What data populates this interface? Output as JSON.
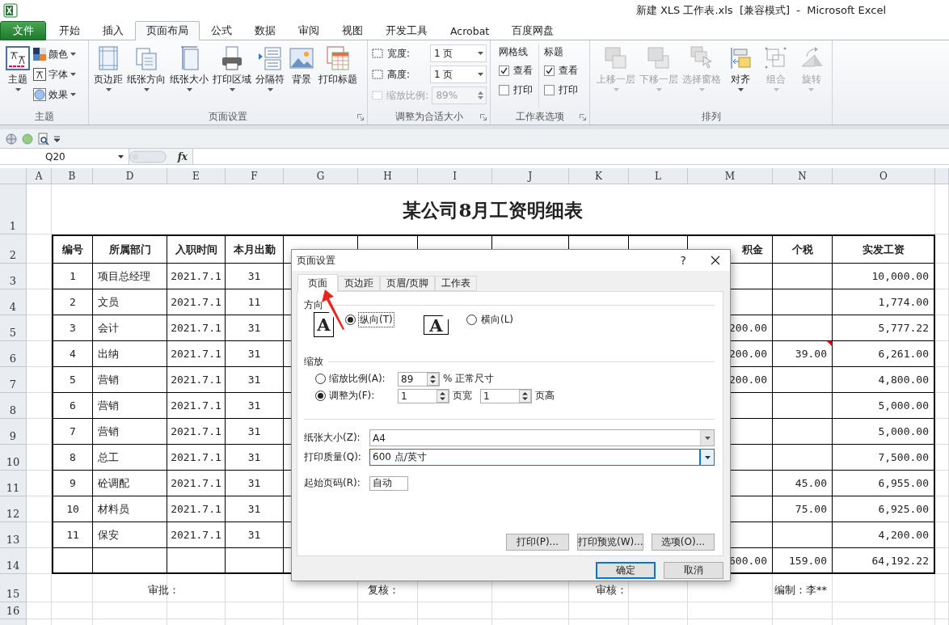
{
  "window": {
    "title": "新建 XLS 工作表.xls  [兼容模式]  -  Microsoft Excel"
  },
  "ribbon_tabs": [
    {
      "label": "文件",
      "kind": "file",
      "selected": false
    },
    {
      "label": "开始",
      "kind": "tab",
      "selected": false
    },
    {
      "label": "插入",
      "kind": "tab",
      "selected": false
    },
    {
      "label": "页面布局",
      "kind": "tab",
      "selected": true
    },
    {
      "label": "公式",
      "kind": "tab",
      "selected": false
    },
    {
      "label": "数据",
      "kind": "tab",
      "selected": false
    },
    {
      "label": "审阅",
      "kind": "tab",
      "selected": false
    },
    {
      "label": "视图",
      "kind": "tab",
      "selected": false
    },
    {
      "label": "开发工具",
      "kind": "tab",
      "selected": false
    },
    {
      "label": "Acrobat",
      "kind": "tab",
      "selected": false
    },
    {
      "label": "百度网盘",
      "kind": "tab",
      "selected": false
    }
  ],
  "ribbon": {
    "theme": {
      "title": "主题",
      "main": "主题",
      "options": [
        "颜色",
        "字体",
        "效果"
      ]
    },
    "page_setup": {
      "title": "页面设置",
      "buttons": [
        {
          "label": "页边距",
          "dropdown": true
        },
        {
          "label": "纸张方向",
          "dropdown": true
        },
        {
          "label": "纸张大小",
          "dropdown": true
        },
        {
          "label": "打印区域",
          "dropdown": true
        },
        {
          "label": "分隔符",
          "dropdown": true
        },
        {
          "label": "背景",
          "dropdown": false
        },
        {
          "label": "打印标题",
          "dropdown": false
        }
      ]
    },
    "scale": {
      "title": "调整为合适大小",
      "fields": [
        {
          "label": "宽度:",
          "value": "1 页",
          "kind": "dropdown",
          "disabled": false
        },
        {
          "label": "高度:",
          "value": "1 页",
          "kind": "dropdown",
          "disabled": false
        },
        {
          "label": "缩放比例:",
          "value": "89%",
          "kind": "spinner",
          "disabled": true
        }
      ]
    },
    "sheet_options": {
      "title": "工作表选项",
      "columns": [
        {
          "title": "网格线",
          "options": [
            {
              "label": "查看",
              "checked": true
            },
            {
              "label": "打印",
              "checked": false
            }
          ]
        },
        {
          "title": "标题",
          "options": [
            {
              "label": "查看",
              "checked": true
            },
            {
              "label": "打印",
              "checked": false
            }
          ]
        }
      ]
    },
    "arrange": {
      "title": "排列",
      "buttons": [
        {
          "label": "上移一层",
          "disabled": true
        },
        {
          "label": "下移一层",
          "disabled": true
        },
        {
          "label": "选择窗格",
          "disabled": true
        },
        {
          "label": "对齐",
          "disabled": false
        },
        {
          "label": "组合",
          "disabled": true
        },
        {
          "label": "旋转",
          "disabled": true
        }
      ]
    }
  },
  "formula_bar": {
    "name_box": "Q20",
    "fx": "fx"
  },
  "sheet": {
    "columns": [
      "A",
      "B",
      "D",
      "E",
      "F",
      "G",
      "H",
      "I",
      "J",
      "K",
      "L",
      "M",
      "N",
      "O"
    ],
    "row_numbers": [
      "1",
      "2",
      "3",
      "4",
      "5",
      "6",
      "7",
      "8",
      "9",
      "10",
      "11",
      "12",
      "13",
      "14",
      "15",
      "16"
    ],
    "title": "某公司8月工资明细表",
    "header": {
      "B": "编号",
      "D": "所属部门",
      "E": "入职时间",
      "F": "本月出勤",
      "M": "积金",
      "N": "个税",
      "O": "实发工资"
    },
    "rows": [
      {
        "B": "1",
        "D": "项目总经理",
        "E": "2021.7.1",
        "F": "31",
        "O": "10,000.00"
      },
      {
        "B": "2",
        "D": "文员",
        "E": "2021.7.1",
        "F": "11",
        "O": "1,774.00"
      },
      {
        "B": "3",
        "D": "会计",
        "E": "2021.7.1",
        "F": "31",
        "M": "200.00",
        "O": "5,777.22"
      },
      {
        "B": "4",
        "D": "出纳",
        "E": "2021.7.1",
        "F": "31",
        "M": "200.00",
        "N": "39.00",
        "O": "6,261.00",
        "comment": true
      },
      {
        "B": "5",
        "D": "营销",
        "E": "2021.7.1",
        "F": "31",
        "M": "200.00",
        "O": "4,800.00"
      },
      {
        "B": "6",
        "D": "营销",
        "E": "2021.7.1",
        "F": "31",
        "O": "5,000.00"
      },
      {
        "B": "7",
        "D": "营销",
        "E": "2021.7.1",
        "F": "31",
        "O": "5,000.00"
      },
      {
        "B": "8",
        "D": "总工",
        "E": "2021.7.1",
        "F": "31",
        "O": "7,500.00"
      },
      {
        "B": "9",
        "D": "砼调配",
        "E": "2021.7.1",
        "F": "31",
        "N": "45.00",
        "O": "6,955.00"
      },
      {
        "B": "10",
        "D": "材料员",
        "E": "2021.7.1",
        "F": "31",
        "N": "75.00",
        "O": "6,925.00"
      },
      {
        "B": "11",
        "D": "保安",
        "E": "2021.7.1",
        "F": "31",
        "O": "4,200.00"
      },
      {
        "M": "600.00",
        "N": "159.00",
        "O": "64,192.22"
      }
    ],
    "signatures": [
      "审批：",
      "复核：",
      "审核：",
      "编制：李**"
    ]
  },
  "dialog": {
    "title": "页面设置",
    "help": "?",
    "tabs": [
      {
        "label": "页面",
        "selected": true
      },
      {
        "label": "页边距",
        "selected": false
      },
      {
        "label": "页眉/页脚",
        "selected": false
      },
      {
        "label": "工作表",
        "selected": false
      }
    ],
    "orientation": {
      "title": "方向",
      "options": [
        {
          "label": "纵向(T)",
          "glyph": "A",
          "kind": "portrait",
          "selected": true
        },
        {
          "label": "横向(L)",
          "glyph": "A",
          "kind": "landscape",
          "selected": false
        }
      ]
    },
    "scaling": {
      "title": "缩放",
      "options": [
        {
          "label": "缩放比例(A):",
          "selected": false
        },
        {
          "label": "调整为(F):",
          "selected": true
        }
      ],
      "scale_value": "89",
      "scale_suffix": "% 正常尺寸",
      "fit_wide": "1",
      "fit_wide_label": "页宽",
      "fit_tall": "1",
      "fit_tall_label": "页高"
    },
    "paper_size": {
      "label": "纸张大小(Z):",
      "value": "A4"
    },
    "print_quality": {
      "label": "打印质量(Q):",
      "value": "600 点/英寸"
    },
    "first_page": {
      "label": "起始页码(R):",
      "value": "自动"
    },
    "buttons": [
      "打印(P)...",
      "打印预览(W)...",
      "选项(O)..."
    ],
    "ok": "确定",
    "cancel": "取消"
  }
}
